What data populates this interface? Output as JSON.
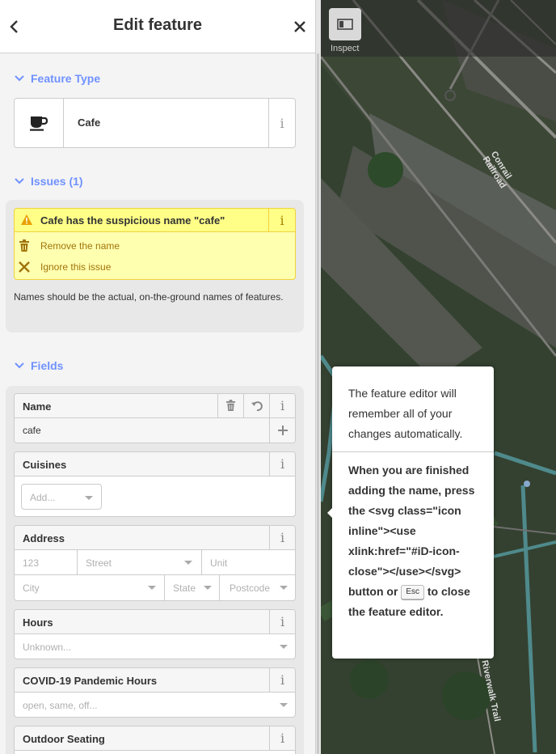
{
  "header": {
    "title": "Edit feature",
    "back_icon": "chevron-left-icon",
    "close_icon": "close-icon"
  },
  "feature_type": {
    "heading": "Feature Type",
    "name": "Cafe",
    "icon": "coffee-cup-icon",
    "info": "i"
  },
  "issues": {
    "heading": "Issues (1)",
    "message": "Cafe has the suspicious name \"cafe\"",
    "fixes": [
      {
        "label": "Remove the name",
        "icon": "trash-icon"
      },
      {
        "label": "Ignore this issue",
        "icon": "close-icon"
      }
    ],
    "note": "Names should be the actual, on-the-ground names of features.",
    "info": "i"
  },
  "fields": {
    "heading": "Fields",
    "name": {
      "label": "Name",
      "value": "cafe",
      "info": "i"
    },
    "cuisines": {
      "label": "Cuisines",
      "placeholder": "Add...",
      "info": "i"
    },
    "address": {
      "label": "Address",
      "housenumber_placeholder": "123",
      "street_placeholder": "Street",
      "unit_placeholder": "Unit",
      "city_placeholder": "City",
      "state_placeholder": "State",
      "postcode_placeholder": "Postcode",
      "info": "i"
    },
    "hours": {
      "label": "Hours",
      "placeholder": "Unknown...",
      "info": "i"
    },
    "covid": {
      "label": "COVID-19 Pandemic Hours",
      "placeholder": "open, same, off...",
      "info": "i"
    },
    "outdoor": {
      "label": "Outdoor Seating",
      "info": "i"
    }
  },
  "map": {
    "inspect_label": "Inspect",
    "tooltip": {
      "text1": "The feature editor will remember all of your changes automatically.",
      "text2": "When you are finished adding the name, press the <svg class=\"icon inline\"><use xlink:href=\"#iD-icon-close\"></use></svg> button or",
      "key": "Esc",
      "text3": "to close the feature editor."
    }
  },
  "colors": {
    "accent": "#7092ff",
    "warning_bg": "#ffff88",
    "warning_text": "#a0740a"
  }
}
